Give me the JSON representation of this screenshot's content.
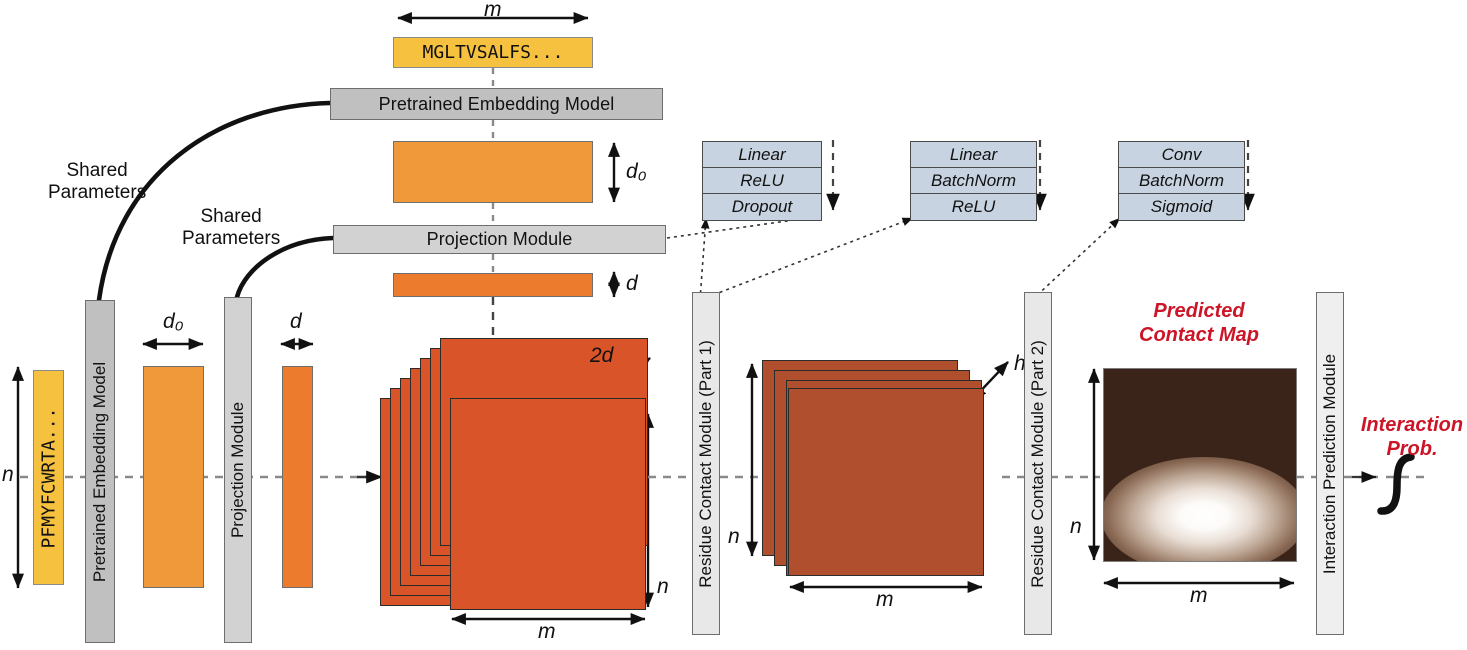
{
  "figure": {
    "title": "Protein-protein interaction prediction architecture",
    "colors": {
      "seq_badge": "#F5C13E",
      "embedding_bar": "#F0993A",
      "projection_bar": "#EC7B2E",
      "stack1": "#D95428",
      "stack2": "#B04F2E",
      "layer_box": "#C7D3E0",
      "module_dark": "#C0C0C0",
      "module_mid": "#D2D2D2",
      "module_light": "#E8E8E8",
      "contact_map_bg": "#3A2318",
      "accent_red": "#CC1628"
    }
  },
  "top_branch": {
    "dim_label_m": "m",
    "sequence": "MGLTVSALFS...",
    "embedding_module": "Pretrained Embedding Model",
    "embedding_out_dim": "d₀",
    "projection_module": "Projection Module",
    "projection_out_dim": "d"
  },
  "left_branch": {
    "dim_label_n": "n",
    "sequence": "PFMYFCWRTA...",
    "embedding_module": "Pretrained Embedding Model",
    "embedding_out_dim": "d₀",
    "projection_module": "Projection Module",
    "projection_out_dim": "d"
  },
  "shared_labels": [
    {
      "line1": "Shared",
      "line2": "Parameters"
    },
    {
      "line1": "Shared",
      "line2": "Parameters"
    }
  ],
  "layer_stacks": [
    {
      "name": "projection-module-layers",
      "layers": [
        "Linear",
        "ReLU",
        "Dropout"
      ]
    },
    {
      "name": "residue-contact-part1-layers",
      "layers": [
        "Linear",
        "BatchNorm",
        "ReLU"
      ]
    },
    {
      "name": "residue-contact-part2-layers",
      "layers": [
        "Conv",
        "BatchNorm",
        "Sigmoid"
      ]
    }
  ],
  "tensor_stacks": [
    {
      "name": "broadcast-tensor",
      "depth_label": "2d",
      "height_label": "n",
      "width_label": "m",
      "sheets": 8,
      "color": "#D95428"
    },
    {
      "name": "hidden-tensor",
      "depth_label": "h",
      "height_label": "n",
      "width_label": "m",
      "sheets": 4,
      "color": "#B04F2E"
    }
  ],
  "modules": {
    "residue_contact_part1": "Residue Contact Module (Part 1)",
    "residue_contact_part2": "Residue Contact Module (Part 2)",
    "interaction_prediction": "Interaction Prediction Module"
  },
  "contact_map": {
    "title_line1": "Predicted",
    "title_line2": "Contact Map",
    "height_label": "n",
    "width_label": "m"
  },
  "output": {
    "label_line1": "Interaction",
    "label_line2": "Prob.",
    "glyph_name": "sigmoid-curve"
  }
}
